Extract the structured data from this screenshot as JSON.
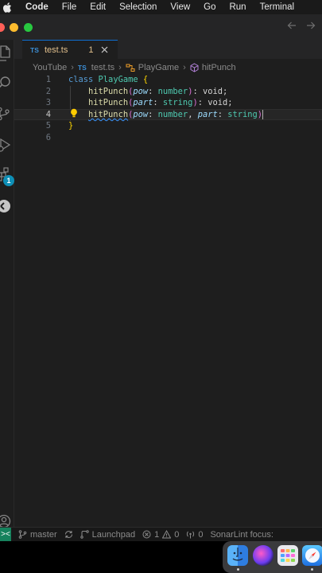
{
  "menubar": {
    "app_name": "Code",
    "items": [
      "File",
      "Edit",
      "Selection",
      "View",
      "Go",
      "Run",
      "Terminal"
    ]
  },
  "tab": {
    "lang": "TS",
    "filename": "test.ts",
    "problem_count": "1"
  },
  "breadcrumb": {
    "folder": "YouTube",
    "lang": "TS",
    "file": "test.ts",
    "class": "PlayGame",
    "method": "hitPunch"
  },
  "activity": {
    "extensions_badge": "1"
  },
  "editor": {
    "current_line": 4,
    "line_numbers": [
      "1",
      "2",
      "3",
      "4",
      "5",
      "6"
    ],
    "line1": {
      "kw": "class",
      "name": "PlayGame",
      "brace": "{"
    },
    "line2": {
      "fn": "hitPunch",
      "p_open": "(",
      "param": "pow",
      "colon": ": ",
      "type": "number",
      "p_close": ")",
      "ret": ": void;"
    },
    "line3": {
      "fn": "hitPunch",
      "p_open": "(",
      "param": "part",
      "colon": ": ",
      "type": "string",
      "p_close": ")",
      "ret": ": void;"
    },
    "line4": {
      "fn": "hitPunch",
      "p_open": "(",
      "param1": "pow",
      "colon1": ": ",
      "type1": "number",
      "comma": ", ",
      "param2": "part",
      "colon2": ": ",
      "type2": "string",
      "p_close": ")"
    },
    "line5": {
      "brace": "}"
    }
  },
  "statusbar": {
    "remote": "><",
    "branch": "master",
    "launchpad": "Launchpad",
    "errors": "1",
    "warnings": "0",
    "ports": "0",
    "sonarlint": "SonarLint focus:"
  },
  "colors": {
    "accent": "#0e8fb6",
    "remote": "#16825d",
    "modified_tab": "#e2c08d"
  }
}
